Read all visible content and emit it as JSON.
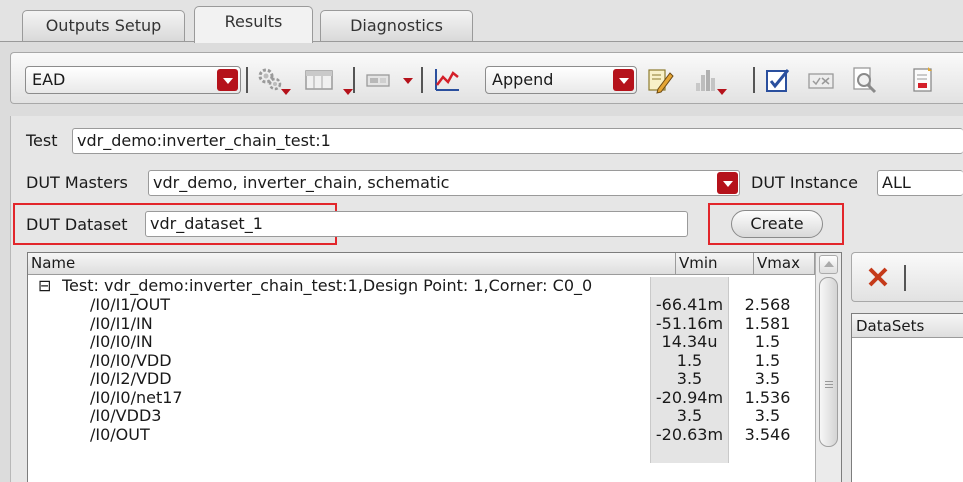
{
  "tabs": [
    {
      "label": "Outputs Setup",
      "active": false
    },
    {
      "label": "Results",
      "active": true
    },
    {
      "label": "Diagnostics",
      "active": false
    }
  ],
  "toolbar": {
    "view_combo_value": "EAD",
    "mode_combo_value": "Append",
    "icons": [
      "settings-gear-icon",
      "table-layout-icon",
      "toggle-switch-icon",
      "line-plot-icon",
      "edit-pencil-icon",
      "histogram-icon",
      "check-notes-icon",
      "check-box-icon",
      "zoom-document-icon",
      "document-report-icon"
    ]
  },
  "form": {
    "test_label": "Test",
    "test_value": "vdr_demo:inverter_chain_test:1",
    "dut_masters_label": "DUT Masters",
    "dut_masters_value": "vdr_demo, inverter_chain, schematic",
    "dut_instance_label": "DUT Instance",
    "dut_instance_value": "ALL",
    "dut_dataset_label": "DUT Dataset",
    "dut_dataset_value": "vdr_dataset_1",
    "create_button": "Create"
  },
  "table": {
    "columns": [
      "Name",
      "Vmin",
      "Vmax"
    ],
    "group_row": {
      "expander": "⊟",
      "label": "Test: vdr_demo:inverter_chain_test:1,Design Point: 1,Corner: C0_0"
    },
    "rows": [
      {
        "name": "/I0/I1/OUT",
        "vmin": "-66.41m",
        "vmax": "2.568"
      },
      {
        "name": "/I0/I1/IN",
        "vmin": "-51.16m",
        "vmax": "1.581"
      },
      {
        "name": "/I0/I0/IN",
        "vmin": "14.34u",
        "vmax": "1.5"
      },
      {
        "name": "/I0/I0/VDD",
        "vmin": "1.5",
        "vmax": "1.5"
      },
      {
        "name": "/I0/I2/VDD",
        "vmin": "3.5",
        "vmax": "3.5"
      },
      {
        "name": "/I0/I0/net17",
        "vmin": "-20.94m",
        "vmax": "1.536"
      },
      {
        "name": "/I0/VDD3",
        "vmin": "3.5",
        "vmax": "3.5"
      },
      {
        "name": "/I0/OUT",
        "vmin": "-20.63m",
        "vmax": "3.546"
      }
    ]
  },
  "right_panel": {
    "datasets_header": "DataSets",
    "delete_icon": "red-x-icon"
  },
  "colors": {
    "highlight": "#e2262b",
    "combo_arrow": "#b5121b"
  }
}
